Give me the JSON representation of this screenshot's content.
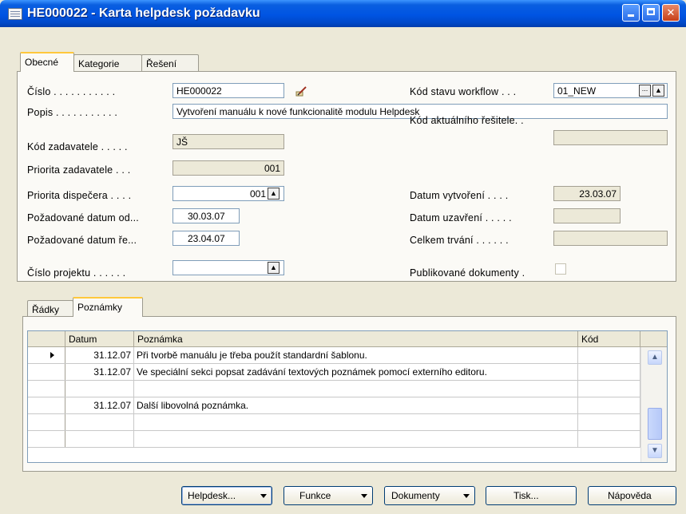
{
  "window": {
    "title": "HE000022 - Karta helpdesk požadavku"
  },
  "top_tabs": [
    "Obecné",
    "Kategorie",
    "Řešení"
  ],
  "form": {
    "cislo": {
      "label": "Číslo . . . . . . . . . . .",
      "value": "HE000022"
    },
    "popis": {
      "label": "Popis . . . . . . . . . . .",
      "value": "Vytvoření manuálu k nové funkcionalitě modulu Helpdesk"
    },
    "kod_zadavatele": {
      "label": "Kód zadavatele . . . . .",
      "value": "JŠ"
    },
    "priorita_zadavatele": {
      "label": "Priorita zadavatele . . .",
      "value": "001"
    },
    "priorita_dispecera": {
      "label": "Priorita dispečera . . . .",
      "value": "001"
    },
    "pozadovane_datum_od": {
      "label": "Požadované datum od...",
      "value": "30.03.07"
    },
    "pozadovane_datum_re": {
      "label": "Požadované datum ře...",
      "value": "23.04.07"
    },
    "cislo_projektu": {
      "label": "Číslo projektu . . . . . .",
      "value": ""
    },
    "kod_stavu_workflow": {
      "label": "Kód stavu workflow . . .",
      "value": "01_NEW"
    },
    "kod_aktualniho_resitele": {
      "label": "Kód aktuálního řešitele. .",
      "value": ""
    },
    "datum_vytvoreni": {
      "label": "Datum vytvoření . . . .",
      "value": "23.03.07"
    },
    "datum_uzavreni": {
      "label": "Datum uzavření . . . . .",
      "value": ""
    },
    "celkem_trvani": {
      "label": "Celkem trvání . . . . . .",
      "value": ""
    },
    "publikovane_dokumenty": {
      "label": "Publikované dokumenty .",
      "checked": false
    }
  },
  "lower_tabs": [
    "Řádky",
    "Poznámky"
  ],
  "notes": {
    "columns": {
      "datum": "Datum",
      "poznamka": "Poznámka",
      "kod": "Kód"
    },
    "rows": [
      {
        "datum": "31.12.07",
        "poznamka": "Při tvorbě manuálu je třeba použít standardní šablonu.",
        "kod": "",
        "current": true
      },
      {
        "datum": "31.12.07",
        "poznamka": "Ve speciální sekci popsat zadávání textových poznámek pomocí externího editoru.",
        "kod": ""
      },
      {
        "datum": "",
        "poznamka": "",
        "kod": ""
      },
      {
        "datum": "31.12.07",
        "poznamka": "Další libovolná poznámka.",
        "kod": ""
      },
      {
        "datum": "",
        "poznamka": "",
        "kod": ""
      },
      {
        "datum": "",
        "poznamka": "",
        "kod": ""
      }
    ]
  },
  "buttons": {
    "helpdesk": "Helpdesk...",
    "funkce": "Funkce",
    "dokumenty": "Dokumenty",
    "tisk": "Tisk...",
    "napoveda": "Nápověda"
  }
}
